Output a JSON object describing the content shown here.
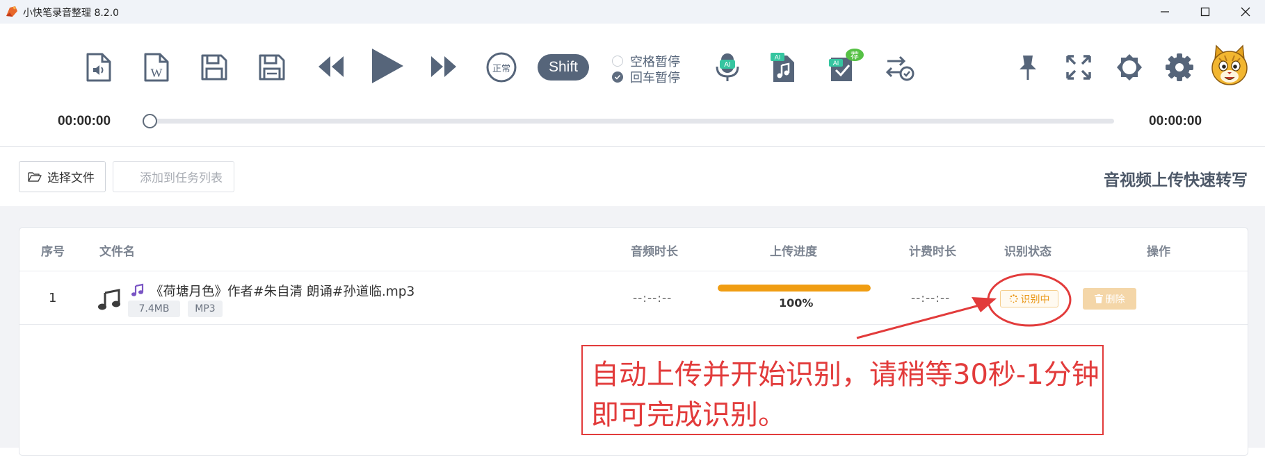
{
  "window": {
    "title": "小快笔录音整理 8.2.0"
  },
  "toolbar": {
    "normal_badge": "正常",
    "shift_label": "Shift",
    "space_pause_label": "空格暂停",
    "enter_pause_label": "回车暂停",
    "enter_pause_checked": true,
    "space_pause_checked": false,
    "recommend_badge": "荐",
    "ai_badge": "AI",
    "current_time": "00:00:00",
    "total_time": "00:00:00",
    "playback_progress": 0
  },
  "actions": {
    "choose_file_label": "选择文件",
    "add_to_task_label": "添加到任务列表",
    "headline": "音视频上传快速转写"
  },
  "table": {
    "headers": {
      "index": "序号",
      "filename": "文件名",
      "audio_duration": "音频时长",
      "upload_progress": "上传进度",
      "billing_duration": "计费时长",
      "recognition_status": "识别状态",
      "operation": "操作"
    },
    "rows": [
      {
        "index": "1",
        "filename": "《荷塘月色》作者#朱自清 朗诵#孙道临.mp3",
        "size": "7.4MB",
        "format": "MP3",
        "audio_duration": "--:--:--",
        "upload_percent": "100%",
        "upload_fraction": 1.0,
        "billing_duration": "--:--:--",
        "status": "识别中",
        "delete_label": "删除"
      }
    ]
  },
  "annotation": {
    "line1": "自动上传并开始识别，请稍等30秒-1分钟",
    "line2": "即可完成识别。"
  },
  "colors": {
    "accent": "#56657a",
    "progress": "#f09d12",
    "status": "#e99614",
    "annotation": "#e23b3b"
  }
}
